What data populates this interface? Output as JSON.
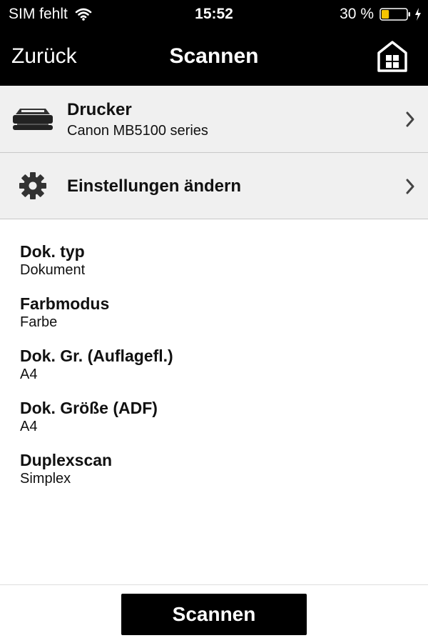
{
  "status_bar": {
    "carrier": "SIM fehlt",
    "time": "15:52",
    "battery_percent": "30 %",
    "battery_level": 0.3,
    "battery_color": "#f5c400",
    "icons": [
      "wifi-icon",
      "battery-icon",
      "charging-bolt-icon"
    ]
  },
  "nav": {
    "back_label": "Zurück",
    "title": "Scannen",
    "home_icon": "home-icon"
  },
  "printer": {
    "title": "Drucker",
    "name": "Canon MB5100 series",
    "icon": "printer-icon"
  },
  "settings_row": {
    "label": "Einstellungen ändern",
    "icon": "gear-icon"
  },
  "settings": [
    {
      "label": "Dok. typ",
      "value": "Dokument"
    },
    {
      "label": "Farbmodus",
      "value": "Farbe"
    },
    {
      "label": "Dok. Gr. (Auflagefl.)",
      "value": "A4"
    },
    {
      "label": "Dok. Größe (ADF)",
      "value": "A4"
    },
    {
      "label": "Duplexscan",
      "value": "Simplex"
    }
  ],
  "scan_button_label": "Scannen",
  "colors": {
    "bar_background": "#000000",
    "row_background": "#f0f0f0",
    "divider": "#c8c8c8"
  }
}
